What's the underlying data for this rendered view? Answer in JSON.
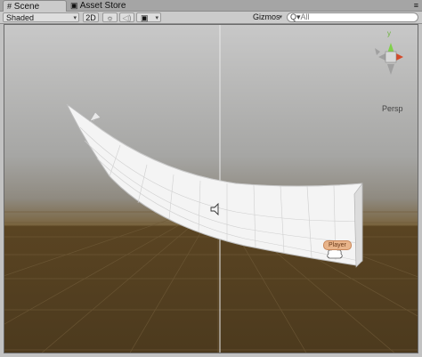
{
  "tabs": [
    {
      "label": "Scene",
      "icon": "scene-grid-icon",
      "active": true
    },
    {
      "label": "Asset Store",
      "icon": "shopping-bag-icon",
      "active": false
    }
  ],
  "toolbar": {
    "shading_mode": "Shaded",
    "mode_2d": "2D",
    "gizmos_label": "Gizmos",
    "search_prefix": "Q▾",
    "search_placeholder": "All",
    "icons": [
      "sun-lighting-icon",
      "speaker-audio-icon",
      "image-effects-icon"
    ]
  },
  "scene": {
    "projection_label": "Persp",
    "player_label": "Player",
    "axis_label": "y",
    "colors": {
      "sky": "#c8c8c8",
      "ground": "#4c3a1e",
      "x_axis": "#d44a2a",
      "y_axis": "#7fd04a",
      "z_axis": "#4a7ad4",
      "player": "#e8b48a"
    }
  }
}
